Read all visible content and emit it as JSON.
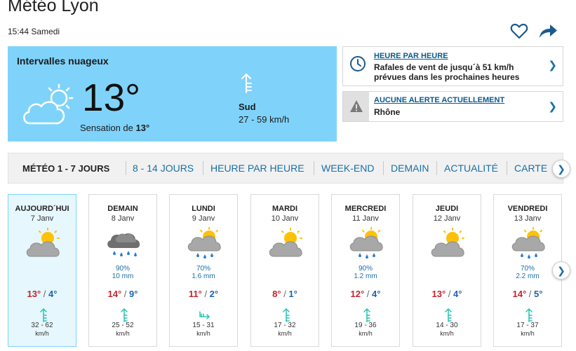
{
  "header": {
    "title": "Météo Lyon",
    "subtitle": "15:44 Samedi"
  },
  "current": {
    "condition": "Intervalles nuageux",
    "temp": "13°",
    "feels_prefix": "Sensation de ",
    "feels_value": "13°",
    "wind_dir": "Sud",
    "wind_speed": "27 - 59 km/h",
    "icon": "partly-cloudy-icon"
  },
  "cards": [
    {
      "heading": "HEURE PAR HEURE",
      "line1": "Rafales de vent de jusqu´à 51 km/h",
      "line2": "prévues dans les prochaines heures",
      "icon": "clock-icon"
    },
    {
      "heading": "AUCUNE ALERTE ACTUELLEMENT",
      "line1": "Rhône",
      "icon": "warning-icon"
    }
  ],
  "tabs": [
    {
      "label": "MÉTÉO 1 - 7 JOURS",
      "active": true
    },
    {
      "label": "8 - 14 JOURS"
    },
    {
      "label": "HEURE PAR HEURE"
    },
    {
      "label": "WEEK-END"
    },
    {
      "label": "DEMAIN"
    },
    {
      "label": "ACTUALITÉ"
    },
    {
      "label": "CARTE"
    }
  ],
  "days": [
    {
      "name": "AUJOURD´HUI",
      "date": "7 Janv",
      "icon": "partly-cloudy-icon",
      "prob": "",
      "mm": "",
      "max": "13°",
      "min": "4°",
      "wind": "32 - 62",
      "unit": "km/h"
    },
    {
      "name": "DEMAIN",
      "date": "8 Janv",
      "icon": "rain-cloud-icon",
      "prob": "90%",
      "mm": "10 mm",
      "max": "14°",
      "min": "9°",
      "wind": "25 - 52",
      "unit": "km/h"
    },
    {
      "name": "LUNDI",
      "date": "9 Janv",
      "icon": "sun-rain-icon",
      "prob": "70%",
      "mm": "1.6 mm",
      "max": "11°",
      "min": "2°",
      "wind": "15 - 31",
      "unit": "km/h"
    },
    {
      "name": "MARDI",
      "date": "10 Janv",
      "icon": "partly-cloudy-icon",
      "prob": "",
      "mm": "",
      "max": "8°",
      "min": "1°",
      "wind": "17 - 32",
      "unit": "km/h"
    },
    {
      "name": "MERCREDI",
      "date": "11 Janv",
      "icon": "sun-rain-icon",
      "prob": "90%",
      "mm": "1.2 mm",
      "max": "12°",
      "min": "4°",
      "wind": "19 - 36",
      "unit": "km/h"
    },
    {
      "name": "JEUDI",
      "date": "12 Janv",
      "icon": "partly-cloudy-icon",
      "prob": "",
      "mm": "",
      "max": "13°",
      "min": "4°",
      "wind": "14 - 30",
      "unit": "km/h"
    },
    {
      "name": "VENDREDI",
      "date": "13 Janv",
      "icon": "sun-rain-icon",
      "prob": "70%",
      "mm": "2.2 mm",
      "max": "14°",
      "min": "5°",
      "wind": "17 - 37",
      "unit": "km/h"
    }
  ],
  "colors": {
    "accent": "#1a6fa4",
    "current_bg": "#7fd3fa",
    "max": "#c4232e",
    "min": "#1d62b0",
    "wind_icon": "#2ac3b4"
  }
}
